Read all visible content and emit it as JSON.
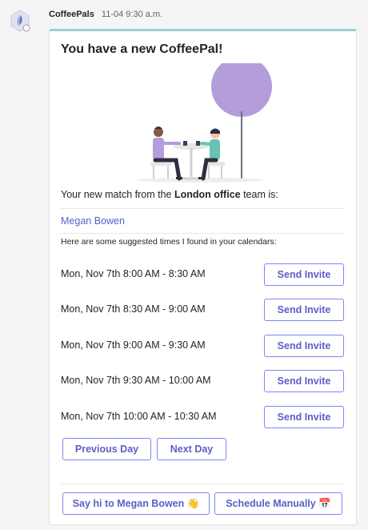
{
  "header": {
    "app_name": "CoffeePals",
    "timestamp": "11-04 9:30 a.m."
  },
  "card": {
    "title": "You have a new CoffeePal!",
    "match_prefix": "Your new match from the ",
    "office": "London office",
    "match_suffix": " team is:",
    "match_name": "Megan Bowen",
    "suggest_text": "Here are some suggested times I found in your calendars:",
    "slots": [
      {
        "time": "Mon, Nov 7th 8:00 AM - 8:30 AM",
        "button": "Send Invite"
      },
      {
        "time": "Mon, Nov 7th 8:30 AM - 9:00 AM",
        "button": "Send Invite"
      },
      {
        "time": "Mon, Nov 7th 9:00 AM - 9:30 AM",
        "button": "Send Invite"
      },
      {
        "time": "Mon, Nov 7th 9:30 AM - 10:00 AM",
        "button": "Send Invite"
      },
      {
        "time": "Mon, Nov 7th 10:00 AM - 10:30 AM",
        "button": "Send Invite"
      }
    ],
    "prev_day": "Previous Day",
    "next_day": "Next Day",
    "say_hi": "Say hi to Megan Bowen 👋",
    "schedule_manually": "Schedule Manually 📅"
  },
  "colors": {
    "accent": "#5b5fc7",
    "tree": "#b39ddb",
    "card_top": "#9fd0d3"
  }
}
